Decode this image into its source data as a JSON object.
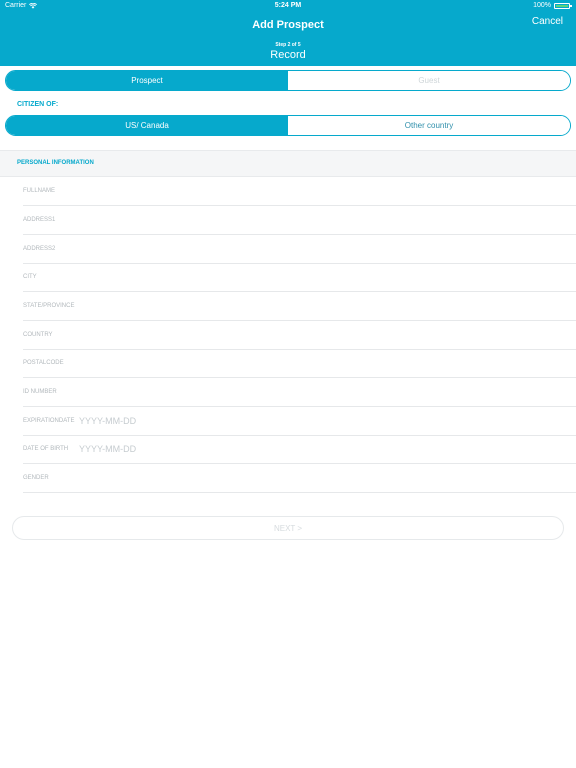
{
  "status_bar": {
    "carrier": "Carrier",
    "time": "5:24 PM",
    "battery": "100%"
  },
  "header": {
    "title": "Add Prospect",
    "cancel_label": "Cancel",
    "step_label": "Step 2 of 5",
    "step_name": "Record"
  },
  "type_selector": {
    "options": [
      "Prospect",
      "Guest"
    ],
    "selected": "Prospect"
  },
  "citizen": {
    "label": "CITIZEN OF:",
    "options": [
      "US/ Canada",
      "Other country"
    ],
    "selected": "US/ Canada"
  },
  "section": {
    "title": "PERSONAL INFORMATION"
  },
  "fields": [
    {
      "label": "FULLNAME",
      "placeholder": ""
    },
    {
      "label": "ADDRESS1",
      "placeholder": ""
    },
    {
      "label": "ADDRESS2",
      "placeholder": ""
    },
    {
      "label": "CITY",
      "placeholder": ""
    },
    {
      "label": "STATE/PROVINCE",
      "placeholder": ""
    },
    {
      "label": "COUNTRY",
      "placeholder": ""
    },
    {
      "label": "POSTALCODE",
      "placeholder": ""
    },
    {
      "label": "ID NUMBER",
      "placeholder": ""
    },
    {
      "label": "EXPIRATIONDATE",
      "placeholder": "YYYY-MM-DD"
    },
    {
      "label": "DATE OF BIRTH",
      "placeholder": "YYYY-MM-DD"
    },
    {
      "label": "GENDER",
      "placeholder": ""
    }
  ],
  "next_button": {
    "label": "NEXT >"
  },
  "colors": {
    "accent": "#06a9cc",
    "battery": "#5ad67d"
  },
  "icons": {
    "wifi": "wifi-icon",
    "battery": "battery-icon"
  }
}
